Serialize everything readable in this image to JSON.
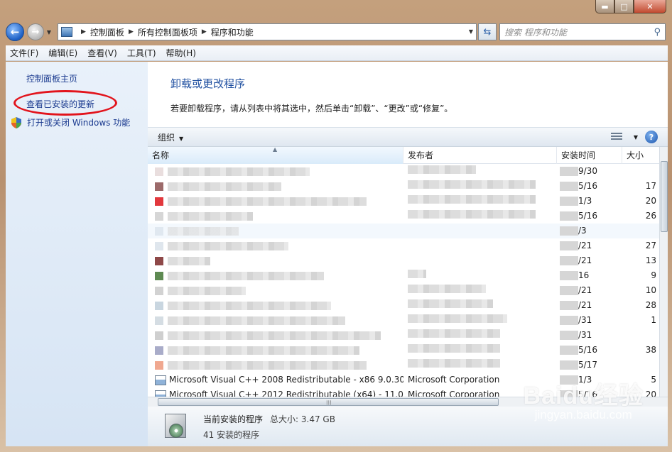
{
  "window": {
    "caption_min": "▬",
    "caption_max": "□",
    "caption_close": "✕"
  },
  "address": {
    "crumbs": [
      "控制面板",
      "所有控制面板项",
      "程序和功能"
    ],
    "search_placeholder": "搜索 程序和功能"
  },
  "menu": {
    "items": [
      "文件(F)",
      "编辑(E)",
      "查看(V)",
      "工具(T)",
      "帮助(H)"
    ]
  },
  "leftnav": {
    "home": "控制面板主页",
    "updates": "查看已安装的更新",
    "features": "打开或关闭 Windows 功能"
  },
  "main": {
    "title": "卸载或更改程序",
    "description": "若要卸载程序，请从列表中将其选中，然后单击“卸载”、“更改”或“修复”。"
  },
  "toolbar": {
    "organize": "组织",
    "help": "?"
  },
  "list": {
    "headers": {
      "name": "名称",
      "publisher": "发布者",
      "date": "安装时间",
      "size": "大小"
    },
    "rows": [
      {
        "date_tail": "9/30",
        "size": ""
      },
      {
        "date_tail": "5/16",
        "size": "17"
      },
      {
        "date_tail": "1/3",
        "size": "20"
      },
      {
        "date_tail": "5/16",
        "size": "26"
      },
      {
        "date_tail": "/3",
        "size": ""
      },
      {
        "date_tail": "/21",
        "size": "27"
      },
      {
        "date_tail": "/21",
        "size": "13"
      },
      {
        "date_tail": "16",
        "size": "9"
      },
      {
        "date_tail": "/21",
        "size": "10"
      },
      {
        "date_tail": "/21",
        "size": "28"
      },
      {
        "date_tail": "/31",
        "size": "1"
      },
      {
        "date_tail": "/31",
        "size": ""
      },
      {
        "date_tail": "5/16",
        "size": "38"
      },
      {
        "date_tail": "5/17",
        "size": ""
      }
    ],
    "visible_rows": [
      {
        "name": "Microsoft Visual C++ 2008 Redistributable - x86 9.0.30...",
        "publisher": "Microsoft Corporation",
        "date_tail": "1/3",
        "size": "5"
      },
      {
        "name": "Microsoft Visual C++ 2012 Redistributable (x64) - 11.0...",
        "publisher": "Microsoft Corporation",
        "date_tail": "5/16",
        "size": "20"
      }
    ]
  },
  "status": {
    "title": "当前安装的程序",
    "total_size": "总大小: 3.47 GB",
    "count": "41 安装的程序"
  },
  "watermark": {
    "logo": "Baidu经验",
    "url": "jingyan.baidu.com"
  }
}
